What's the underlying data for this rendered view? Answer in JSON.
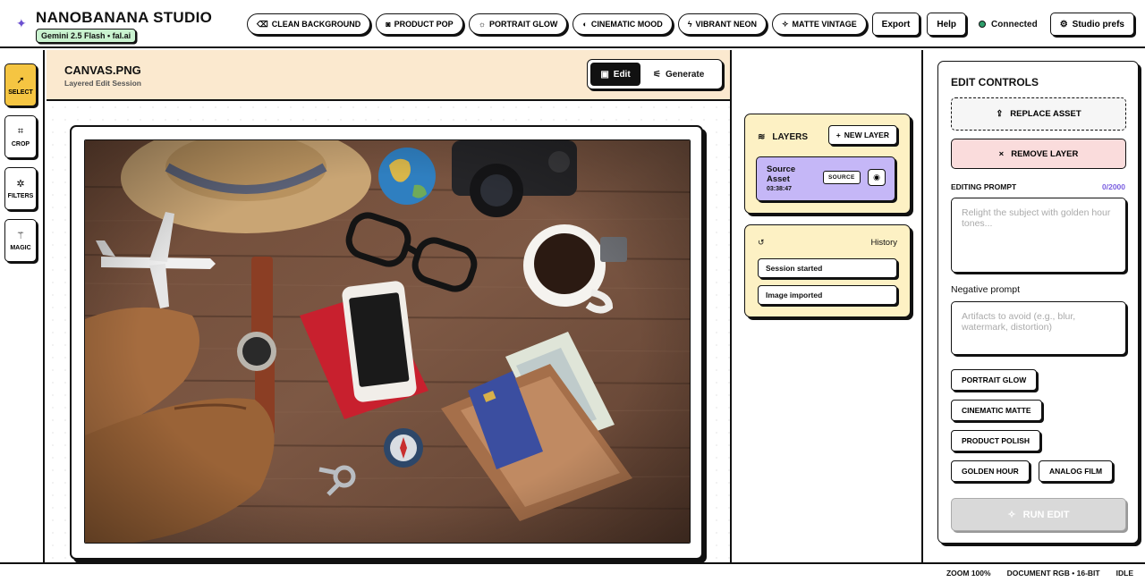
{
  "brand": {
    "title": "NANOBANANA STUDIO",
    "badge": "Gemini 2.5 Flash • fal.ai",
    "icon": "sparkle-icon"
  },
  "presets": [
    {
      "label": "CLEAN BACKGROUND",
      "icon": "eraser-icon"
    },
    {
      "label": "PRODUCT POP",
      "icon": "camera-icon"
    },
    {
      "label": "PORTRAIT GLOW",
      "icon": "sun-icon"
    },
    {
      "label": "CINEMATIC MOOD",
      "icon": "palette-icon"
    },
    {
      "label": "VIBRANT NEON",
      "icon": "bolt-icon"
    },
    {
      "label": "MATTE VINTAGE",
      "icon": "sparkles-icon"
    }
  ],
  "topbar": {
    "export": "Export",
    "help": "Help",
    "connection": "Connected",
    "prefs": "Studio prefs",
    "status_color": "#2e9e6b"
  },
  "tools": [
    {
      "label": "SELECT",
      "icon": "cursor-icon",
      "active": true
    },
    {
      "label": "CROP",
      "icon": "crop-icon",
      "active": false
    },
    {
      "label": "FILTERS",
      "icon": "filters-icon",
      "active": false
    },
    {
      "label": "MAGIC",
      "icon": "magic-wand-icon",
      "active": false
    }
  ],
  "canvas": {
    "file_title": "CANVAS.PNG",
    "file_subtitle": "Layered Edit Session",
    "mode_edit": "Edit",
    "mode_generate": "Generate",
    "active_mode": "Edit"
  },
  "layers": {
    "title": "LAYERS",
    "new_layer": "NEW LAYER",
    "items": [
      {
        "name": "Source Asset",
        "time": "03:38:47",
        "tag": "SOURCE"
      }
    ]
  },
  "history": {
    "title": "History",
    "items": [
      "Session started",
      "Image imported"
    ]
  },
  "edit_controls": {
    "title": "EDIT CONTROLS",
    "replace": "REPLACE ASSET",
    "remove": "REMOVE LAYER",
    "prompt_label": "EDITING PROMPT",
    "prompt_count": "0/2000",
    "prompt_placeholder": "Relight the subject with golden hour tones...",
    "negative_label": "Negative prompt",
    "negative_placeholder": "Artifacts to avoid (e.g., blur, watermark, distortion)",
    "quick_presets": [
      "PORTRAIT GLOW",
      "CINEMATIC MATTE",
      "PRODUCT POLISH",
      "GOLDEN HOUR",
      "ANALOG FILM"
    ],
    "run": "RUN EDIT"
  },
  "statusbar": {
    "zoom": "ZOOM 100%",
    "document": "DOCUMENT RGB • 16-BIT",
    "state": "IDLE"
  },
  "colors": {
    "accent_yellow": "#f5c542",
    "header_peach": "#fbe9cf",
    "card_cream": "#fdf1c4",
    "layer_violet": "#c5b7f7",
    "danger_pink": "#fadcdc",
    "badge_green": "#c9f2cf"
  }
}
